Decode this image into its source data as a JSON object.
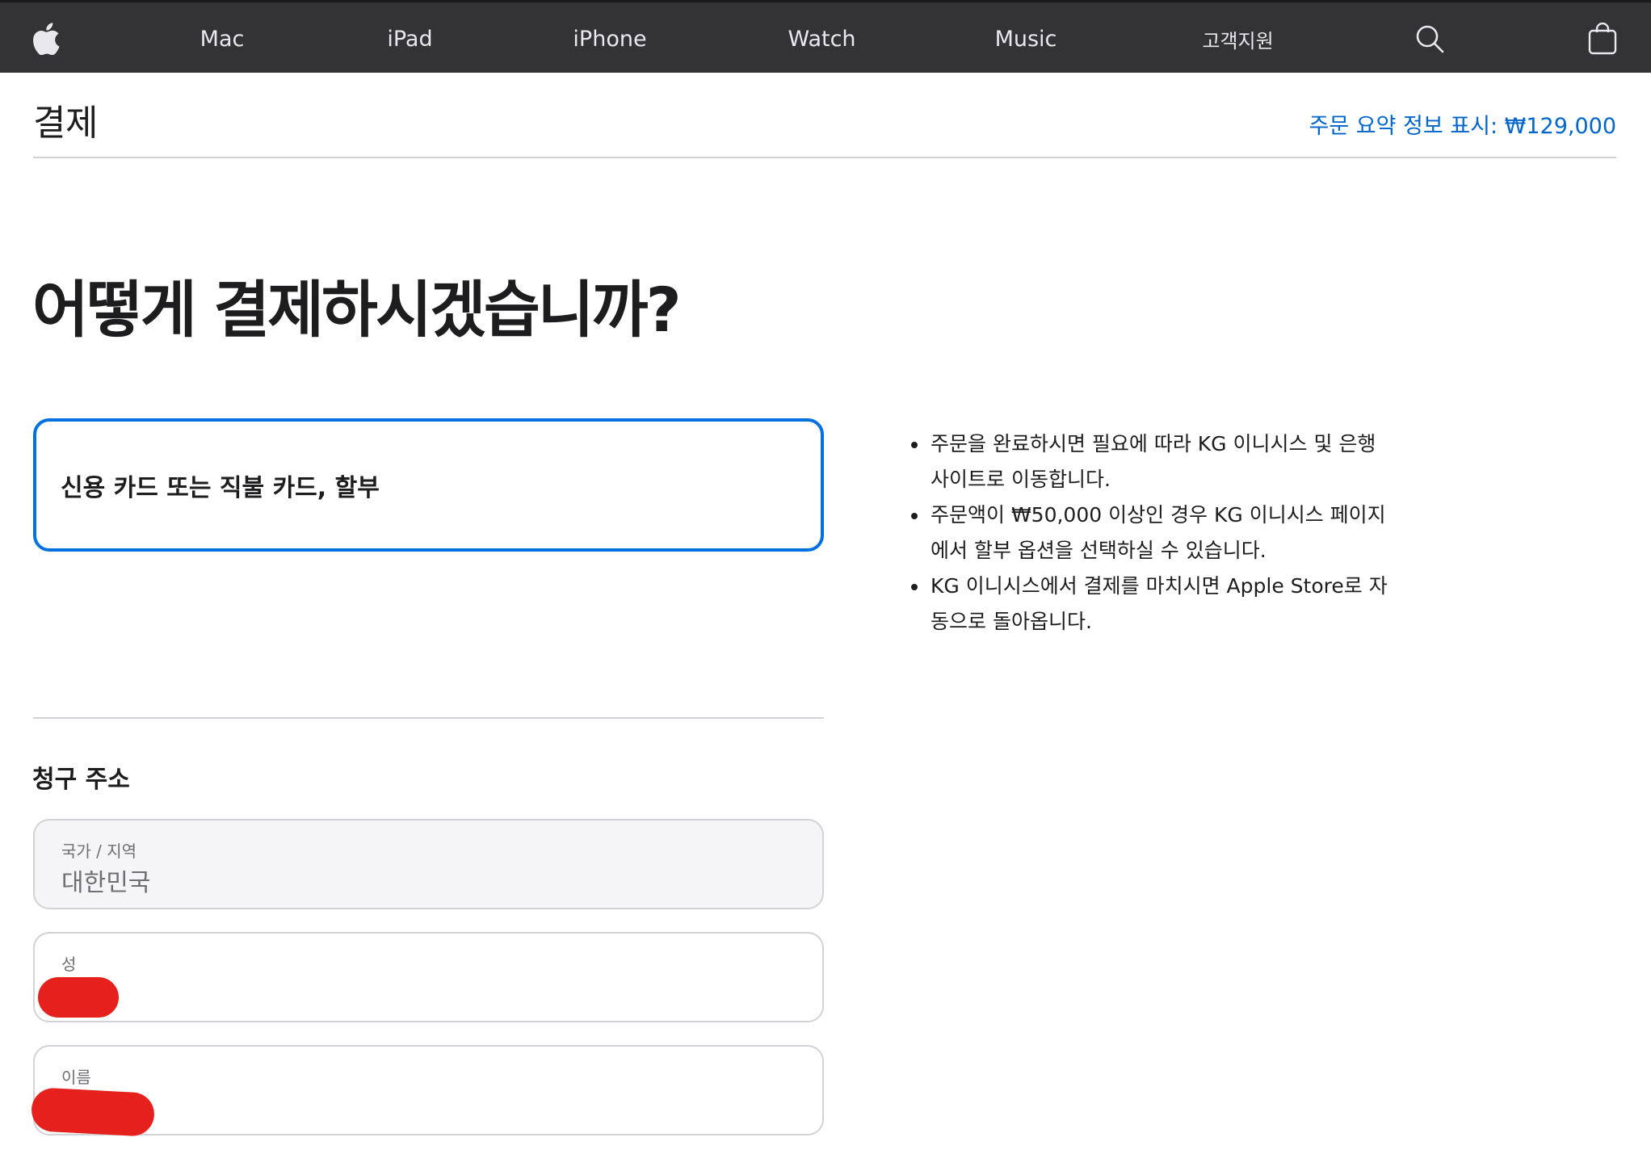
{
  "nav": {
    "items": [
      {
        "id": "apple",
        "label": "",
        "icon": "apple-logo-icon"
      },
      {
        "id": "mac",
        "label": "Mac"
      },
      {
        "id": "ipad",
        "label": "iPad"
      },
      {
        "id": "iphone",
        "label": "iPhone"
      },
      {
        "id": "watch",
        "label": "Watch"
      },
      {
        "id": "music",
        "label": "Music"
      },
      {
        "id": "support",
        "label": "고객지원"
      },
      {
        "id": "search",
        "label": "",
        "icon": "search-icon"
      },
      {
        "id": "bag",
        "label": "",
        "icon": "shopping-bag-icon"
      }
    ],
    "background": "#333336"
  },
  "header": {
    "title": "결제",
    "summary_link": "주문 요약 정보 표시: ₩129,000"
  },
  "main": {
    "heading": "어떻게 결제하시겠습니까?",
    "payment_option": "신용 카드 또는 직불 카드, 할부",
    "info": [
      "주문을 완료하시면 필요에 따라 KG 이니시스 및 은행 사이트로 이동합니다.",
      "주문액이 ₩50,000 이상인 경우 KG 이니시스 페이지에서 할부 옵션을 선택하실 수 있습니다.",
      "KG 이니시스에서 결제를 마치시면 Apple Store로 자동으로 돌아옵니다."
    ]
  },
  "billing": {
    "heading": "청구 주소",
    "fields": [
      {
        "label": "국가 / 지역",
        "value": "대한민국"
      },
      {
        "label": "성",
        "value": ""
      },
      {
        "label": "이름",
        "value": ""
      }
    ]
  },
  "colors": {
    "accent": "#0071e3",
    "link": "#0066cc",
    "redaction": "#e5201d"
  }
}
